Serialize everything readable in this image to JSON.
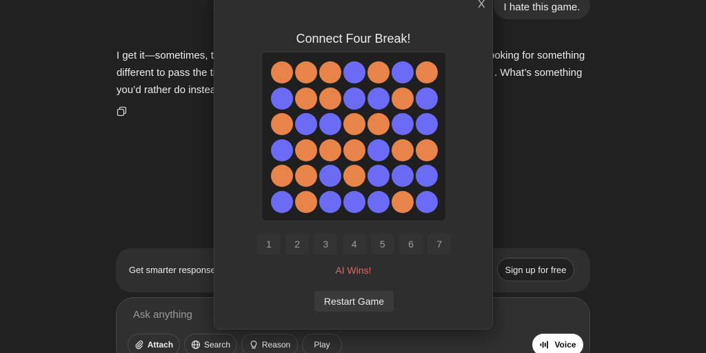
{
  "chat": {
    "user_message": "I hate this game.",
    "assistant_line1": "I get it—sometimes, th",
    "assistant_line1_tail": "ooking for something",
    "assistant_line2": "different to pass the ti",
    "assistant_line2_tail": ". What’s something",
    "assistant_line3": "you’d rather do instead"
  },
  "banner": {
    "text": "Get smarter responses",
    "signup_label": "Sign up for free"
  },
  "composer": {
    "placeholder": "Ask anything",
    "attach_label": "Attach",
    "search_label": "Search",
    "reason_label": "Reason",
    "play_label": "Play",
    "voice_label": "Voice"
  },
  "game": {
    "close_label": "X",
    "title": "Connect Four Break!",
    "columns": [
      "1",
      "2",
      "3",
      "4",
      "5",
      "6",
      "7"
    ],
    "status": "AI Wins!",
    "restart_label": "Restart Game",
    "colors": {
      "orange": "#e8844a",
      "blue": "#6b6bf6",
      "status": "#e06666"
    },
    "board": [
      [
        "orange",
        "orange",
        "orange",
        "blue",
        "orange",
        "blue",
        "orange"
      ],
      [
        "blue",
        "orange",
        "orange",
        "blue",
        "blue",
        "orange",
        "blue"
      ],
      [
        "orange",
        "blue",
        "blue",
        "orange",
        "orange",
        "blue",
        "blue"
      ],
      [
        "blue",
        "orange",
        "orange",
        "orange",
        "blue",
        "orange",
        "orange"
      ],
      [
        "orange",
        "orange",
        "blue",
        "orange",
        "blue",
        "blue",
        "blue"
      ],
      [
        "blue",
        "orange",
        "blue",
        "blue",
        "blue",
        "orange",
        "blue"
      ]
    ]
  }
}
